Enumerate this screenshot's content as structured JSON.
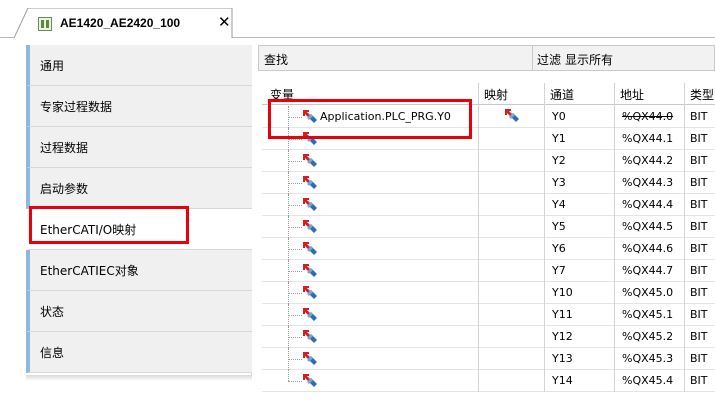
{
  "tab": {
    "title": "AE1420_AE2420_100",
    "close_symbol": "✕",
    "icon": "device-icon"
  },
  "nav": {
    "items": [
      {
        "label": "通用"
      },
      {
        "label": "专家过程数据"
      },
      {
        "label": "过程数据"
      },
      {
        "label": "启动参数"
      },
      {
        "label": "EtherCATI/O映射"
      },
      {
        "label": "EtherCATIEC对象"
      },
      {
        "label": "状态"
      },
      {
        "label": "信息"
      }
    ],
    "active_label": "EtherCATI/O映射"
  },
  "toolbar": {
    "find_label": "查找",
    "filter_label": "过滤",
    "filter_value": "显示所有"
  },
  "table": {
    "headers": {
      "variable": "变量",
      "mapping": "映射",
      "channel": "通道",
      "address": "地址",
      "type": "类型"
    },
    "rows": [
      {
        "variable": "Application.PLC_PRG.Y0",
        "mapped": true,
        "channel": "Y0",
        "address": "%QX44.0",
        "type": "BIT",
        "address_struck": true
      },
      {
        "variable": "",
        "mapped": false,
        "channel": "Y1",
        "address": "%QX44.1",
        "type": "BIT",
        "address_struck": false
      },
      {
        "variable": "",
        "mapped": false,
        "channel": "Y2",
        "address": "%QX44.2",
        "type": "BIT",
        "address_struck": false
      },
      {
        "variable": "",
        "mapped": false,
        "channel": "Y3",
        "address": "%QX44.3",
        "type": "BIT",
        "address_struck": false
      },
      {
        "variable": "",
        "mapped": false,
        "channel": "Y4",
        "address": "%QX44.4",
        "type": "BIT",
        "address_struck": false
      },
      {
        "variable": "",
        "mapped": false,
        "channel": "Y5",
        "address": "%QX44.5",
        "type": "BIT",
        "address_struck": false
      },
      {
        "variable": "",
        "mapped": false,
        "channel": "Y6",
        "address": "%QX44.6",
        "type": "BIT",
        "address_struck": false
      },
      {
        "variable": "",
        "mapped": false,
        "channel": "Y7",
        "address": "%QX44.7",
        "type": "BIT",
        "address_struck": false
      },
      {
        "variable": "",
        "mapped": false,
        "channel": "Y10",
        "address": "%QX45.0",
        "type": "BIT",
        "address_struck": false
      },
      {
        "variable": "",
        "mapped": false,
        "channel": "Y11",
        "address": "%QX45.1",
        "type": "BIT",
        "address_struck": false
      },
      {
        "variable": "",
        "mapped": false,
        "channel": "Y12",
        "address": "%QX45.2",
        "type": "BIT",
        "address_struck": false
      },
      {
        "variable": "",
        "mapped": false,
        "channel": "Y13",
        "address": "%QX45.3",
        "type": "BIT",
        "address_struck": false
      },
      {
        "variable": "",
        "mapped": false,
        "channel": "Y14",
        "address": "%QX45.4",
        "type": "BIT",
        "address_struck": false
      }
    ]
  },
  "colors": {
    "highlight": "#e8000b",
    "nav_accent": "#8fb8df",
    "icon_red": "#d42020",
    "icon_blue": "#2d6db5"
  }
}
